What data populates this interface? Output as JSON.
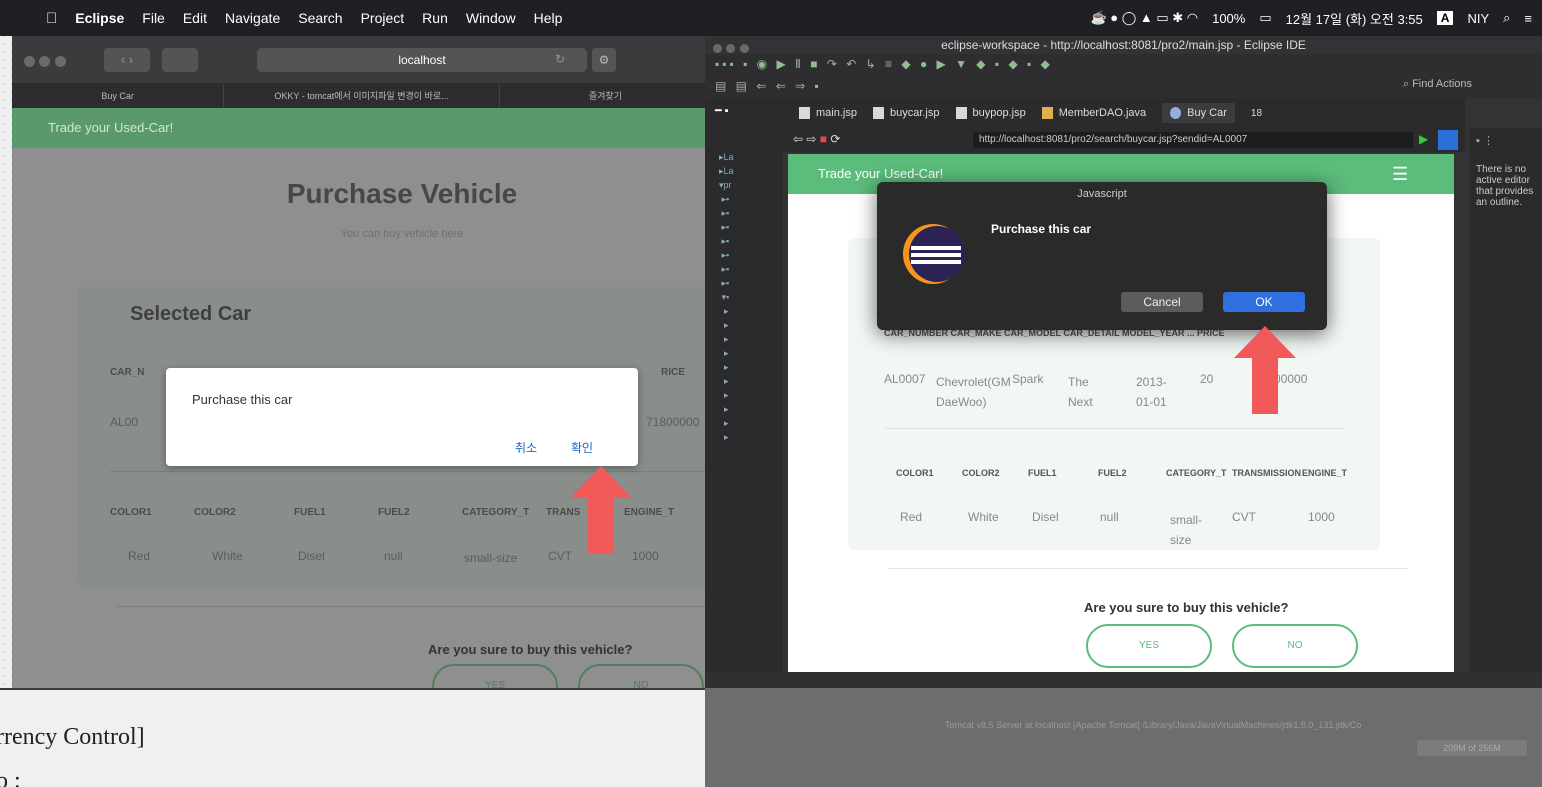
{
  "menubar": {
    "app": "Eclipse",
    "items": [
      "File",
      "Edit",
      "Navigate",
      "Search",
      "Project",
      "Run",
      "Window",
      "Help"
    ],
    "battery": "100%",
    "datetime": "12월 17일 (화) 오전 3:55",
    "input_badge": "A",
    "user": "NIY"
  },
  "safari": {
    "url": "localhost",
    "tabs": [
      "Buy Car",
      "OKKY - tomcat에서 이미지파일 변경이 바로...",
      "즐겨찾기"
    ],
    "brand": "Trade your Used-Car!",
    "page_title": "Purchase Vehicle",
    "page_subtitle": "You can buy vehicle here",
    "card_title": "Selected Car",
    "table1": {
      "header_partial_left": "CAR_N",
      "header_partial_right": "RICE",
      "value_partial_left": "AL00",
      "value_partial_right": "71800000"
    },
    "table2": {
      "headers": [
        "COLOR1",
        "COLOR2",
        "FUEL1",
        "FUEL2",
        "CATEGORY_T",
        "TRANS",
        "ENGINE_T"
      ],
      "values": [
        "Red",
        "White",
        "Disel",
        "null",
        "small-size",
        "CVT",
        "1000"
      ]
    },
    "question": "Are you sure to buy this vehicle?",
    "yes": "YES",
    "no": "NO",
    "dialog": {
      "message": "Purchase this car",
      "cancel": "취소",
      "ok": "확인"
    }
  },
  "eclipse": {
    "title": "eclipse-workspace - http://localhost:8081/pro2/main.jsp - Eclipse IDE",
    "find_actions": "Find Actions",
    "tabs": [
      "main.jsp",
      "buycar.jsp",
      "buypop.jsp",
      "MemberDAO.java",
      "Buy Car"
    ],
    "tab_overflow": "18",
    "address": "http://localhost:8081/pro2/search/buycar.jsp?sendid=AL0007",
    "brand": "Trade your Used-Car!",
    "table1": {
      "headers": "CAR_NUMBER CAR_MAKE CAR_MODEL CAR_DETAIL MODEL_YEAR ... PRICE",
      "values": [
        "AL0007",
        "Chevrolet(GM DaeWoo)",
        "Spark",
        "The Next",
        "2013-01-01",
        "20",
        "71800000"
      ]
    },
    "table2": {
      "headers": [
        "COLOR1",
        "COLOR2",
        "FUEL1",
        "FUEL2",
        "CATEGORY_T",
        "TRANSMISSION",
        "ENGINE_T"
      ],
      "values": [
        "Red",
        "White",
        "Disel",
        "null",
        "small-size",
        "CVT",
        "1000"
      ]
    },
    "question": "Are you sure to buy this vehicle?",
    "yes": "YES",
    "no": "NO",
    "js_dialog": {
      "title": "Javascript",
      "message": "Purchase this car",
      "cancel": "Cancel",
      "ok": "OK"
    },
    "outline_message": "There is no active editor that provides an outline.",
    "console_status": "Tomcat v8.5 Server at localhost [Apache Tomcat] /Library/Java/JavaVirtualMachines/jdk1.8.0_131.jdk/Co",
    "memory": "209M of 256M"
  },
  "overlay": {
    "text": "rrency Control]",
    "text2": "o :"
  }
}
